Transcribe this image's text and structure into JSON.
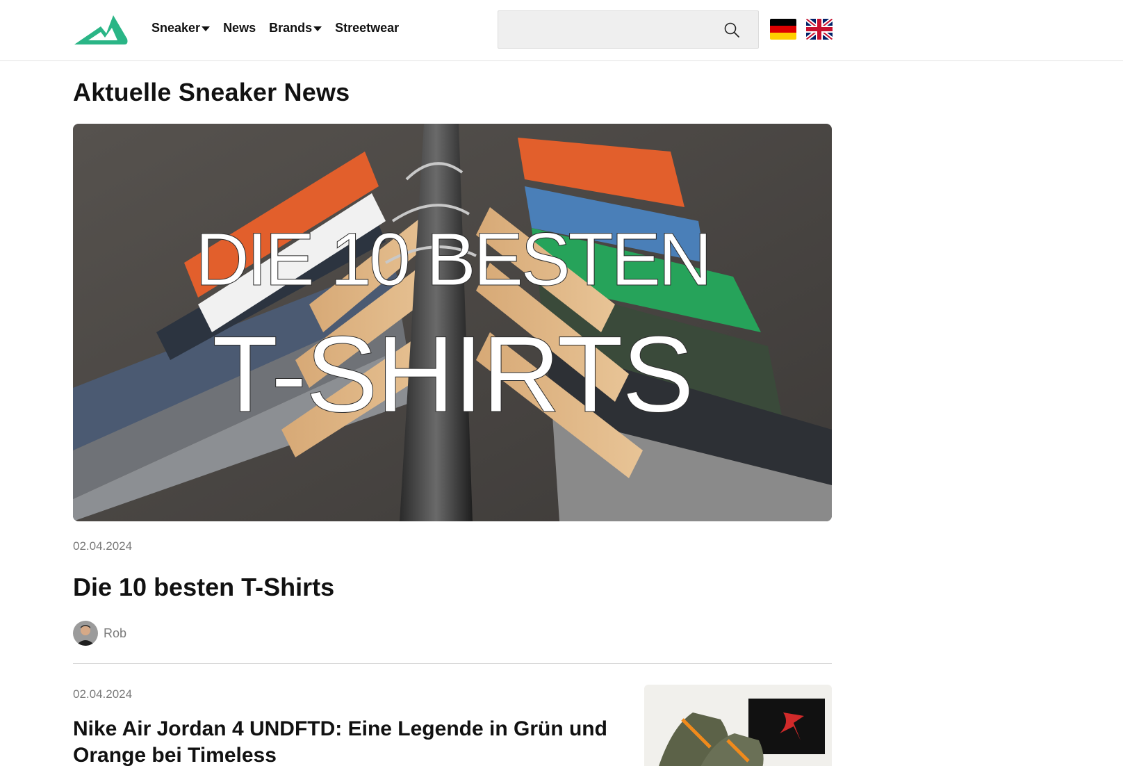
{
  "header": {
    "logo_icon": "sneaker-mountain-logo",
    "nav": [
      {
        "label": "Sneaker",
        "has_dropdown": true
      },
      {
        "label": "News",
        "has_dropdown": false
      },
      {
        "label": "Brands",
        "has_dropdown": true
      },
      {
        "label": "Streetwear",
        "has_dropdown": false
      }
    ],
    "search": {
      "value": "",
      "placeholder": "",
      "icon": "search-icon"
    },
    "languages": [
      {
        "code": "de",
        "icon": "german-flag-icon"
      },
      {
        "code": "en",
        "icon": "uk-flag-icon"
      }
    ]
  },
  "main": {
    "title": "Aktuelle Sneaker News",
    "featured": {
      "image_text": [
        "DIE 10 BESTEN",
        "T-SHIRTS"
      ],
      "date": "02.04.2024",
      "title": "Die 10 besten T-Shirts",
      "author": "Rob"
    },
    "second": {
      "date": "02.04.2024",
      "title": "Nike Air Jordan 4 UNDFTD: Eine Legende in Grün und Orange bei Timeless"
    }
  },
  "colors": {
    "brand_green": "#2ab586",
    "text": "#111111",
    "muted": "#7a7a7a",
    "search_bg": "#efefef"
  }
}
